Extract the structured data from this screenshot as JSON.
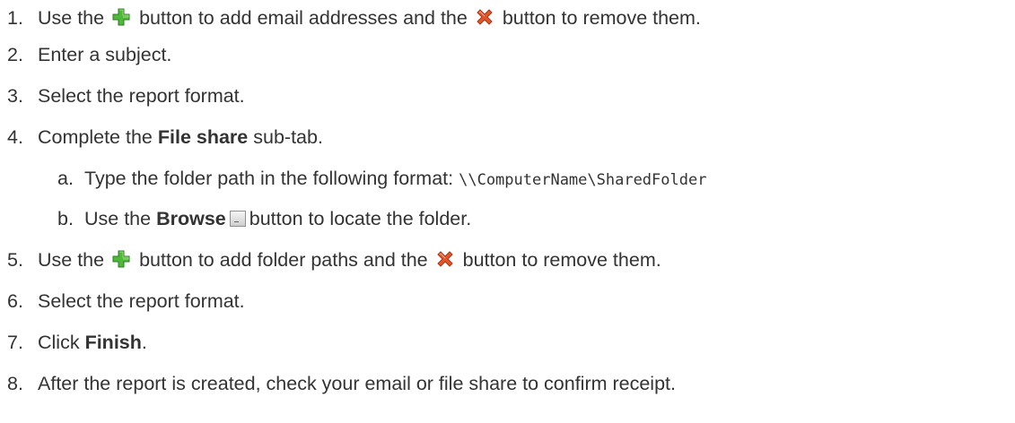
{
  "steps": [
    {
      "n": "1.",
      "a": "Use the",
      "b": "button to add email addresses and the",
      "c": "button to remove them."
    },
    {
      "n": "2.",
      "text": "Enter a subject."
    },
    {
      "n": "3.",
      "text": "Select the report format."
    },
    {
      "n": "4.",
      "pre": "Complete the",
      "bold": "File share",
      "post": "sub-tab."
    },
    {
      "n": "a.",
      "text": "Type the folder path in the following format:",
      "code": "\\\\ComputerName\\SharedFolder"
    },
    {
      "n": "b.",
      "pre": "Use the",
      "bold": "Browse",
      "post": "button to locate the folder."
    },
    {
      "n": "5.",
      "a": "Use the",
      "b": "button to add folder paths and the",
      "c": "button to remove them."
    },
    {
      "n": "6.",
      "text": "Select the report format."
    },
    {
      "n": "7.",
      "pre": "Click",
      "bold": "Finish",
      "post": "."
    },
    {
      "n": "8.",
      "text": "After the report is created, check your email or file share to confirm receipt."
    }
  ],
  "icons": {
    "add": "green-plus-icon",
    "remove": "red-x-icon",
    "browse": "browse-button-icon"
  },
  "colors": {
    "text": "#333333",
    "add_icon": "#4fb83a",
    "remove_icon": "#e2562b"
  }
}
